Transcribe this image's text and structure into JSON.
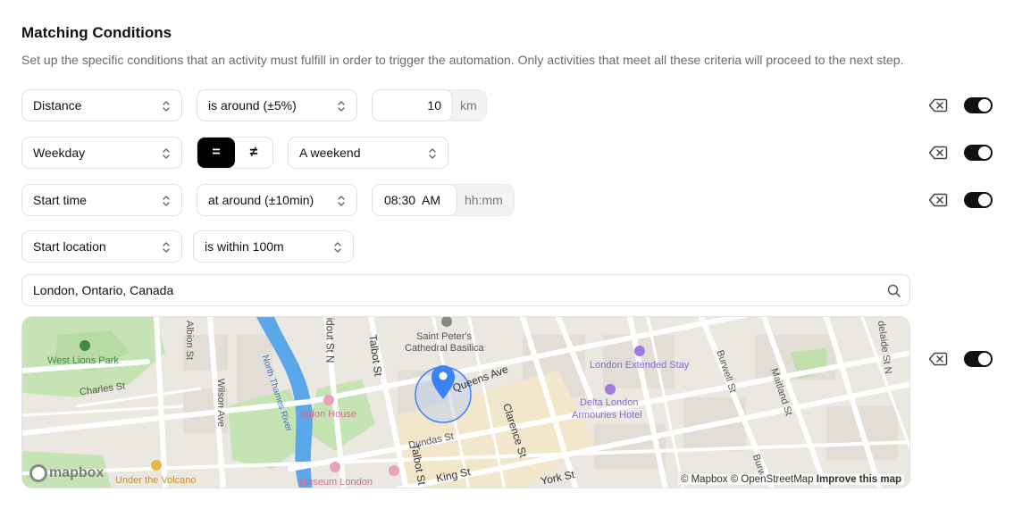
{
  "header": {
    "title": "Matching Conditions",
    "description": "Set up the specific conditions that an activity must fulfill in order to trigger the automation. Only activities that meet all these criteria will proceed to the next step."
  },
  "conditions": {
    "distance": {
      "field": "Distance",
      "operator": "is around (±5%)",
      "value": "10",
      "unit": "km",
      "enabled": true
    },
    "weekday": {
      "field": "Weekday",
      "equal": "=",
      "not_equal": "≠",
      "selected_operator": "=",
      "value": "A weekend",
      "enabled": true
    },
    "start_time": {
      "field": "Start time",
      "operator": "at around (±10min)",
      "value": "08:30  AM",
      "format_hint": "hh:mm",
      "enabled": true
    },
    "start_location": {
      "field": "Start location",
      "operator": "is within 100m",
      "search_value": "London, Ontario, Canada",
      "enabled": true
    }
  },
  "map": {
    "labels": {
      "west_lions_park": "West Lions Park",
      "charles_st": "Charles St",
      "albion_st": "Albion St",
      "wilson_ave": "Wilson Ave",
      "north_thames_river": "North Thames River",
      "eldon_house": "Eldon House",
      "under_the_volcano": "Under the Volcano",
      "museum_london": "Museum London",
      "ridout_st": "idout St N",
      "talbot_st_n": "Talbot St",
      "talbot_st_s": "Talbot St",
      "dundas_st": "Dundas St",
      "king_st": "King St",
      "york_st": "York St",
      "queens_ave": "Queens Ave",
      "clarence_st": "Clarence St",
      "saint_peters_1": "Saint Peter's",
      "saint_peters_2": "Cathedral Basilica",
      "london_extended_stay": "London Extended Stay",
      "delta_london_1": "Delta London",
      "delta_london_2": "Armouries Hotel",
      "burwell_st": "Burwell St",
      "maitland_st": "Maitland St",
      "adelaide_st": "delaide St N",
      "burwell_s": "Burw"
    },
    "logo": "mapbox",
    "attribution": {
      "mapbox": "© Mapbox",
      "osm": "© OpenStreetMap",
      "improve": "Improve this map"
    },
    "colors": {
      "water": "#5aa7ea",
      "park": "#c6e3b4",
      "road": "#ffffff",
      "marker": "#3b82f6"
    }
  }
}
